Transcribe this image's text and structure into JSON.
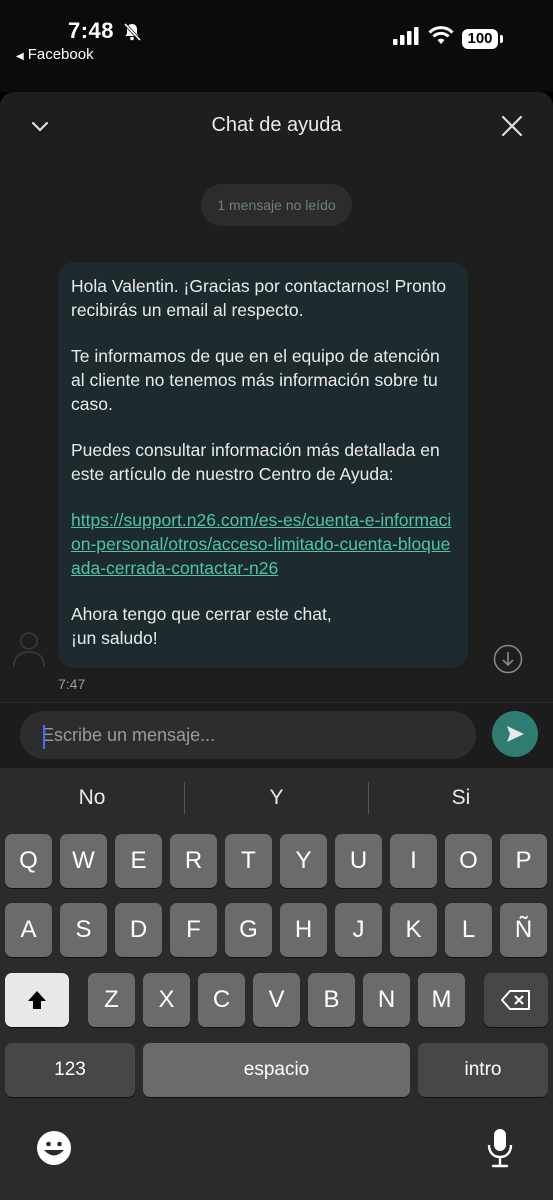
{
  "status_bar": {
    "time": "7:48",
    "back_app": "Facebook",
    "battery": "100"
  },
  "header": {
    "title": "Chat de ayuda"
  },
  "chat": {
    "unread": "1 mensaje no leído",
    "message": {
      "p1": "Hola Valentin. ¡Gracias por contactarnos! Pronto recibirás un email al respecto.",
      "p2": "Te informamos de que en el equipo de atención al cliente no tenemos más información sobre tu caso.",
      "p3": "Puedes consultar información más detallada en este artículo de nuestro Centro de Ayuda:",
      "link": "https://support.n26.com/es-es/cuenta-e-informacion-personal/otros/acceso-limitado-cuenta-bloqueada-cerrada-contactar-n26",
      "p4a": "Ahora tengo que cerrar este chat,",
      "p4b": "¡un saludo!"
    },
    "time": "7:47"
  },
  "composer": {
    "placeholder": "Escribe un mensaje..."
  },
  "keyboard": {
    "suggestions": [
      "No",
      "Y",
      "Si"
    ],
    "row1": [
      "Q",
      "W",
      "E",
      "R",
      "T",
      "Y",
      "U",
      "I",
      "O",
      "P"
    ],
    "row2": [
      "A",
      "S",
      "D",
      "F",
      "G",
      "H",
      "J",
      "K",
      "L",
      "Ñ"
    ],
    "row3": [
      "Z",
      "X",
      "C",
      "V",
      "B",
      "N",
      "M"
    ],
    "numbers": "123",
    "space": "espacio",
    "return": "intro"
  },
  "colors": {
    "accent": "#4fc3ae",
    "send_button": "#2f7d72",
    "bubble": "#1d2a2e"
  },
  "icons": [
    "bell-slash-icon",
    "signal-icon",
    "wifi-icon",
    "chevron-down-icon",
    "close-icon",
    "avatar-icon",
    "scroll-down-icon",
    "send-icon",
    "shift-icon",
    "backspace-icon",
    "emoji-icon",
    "mic-icon"
  ]
}
